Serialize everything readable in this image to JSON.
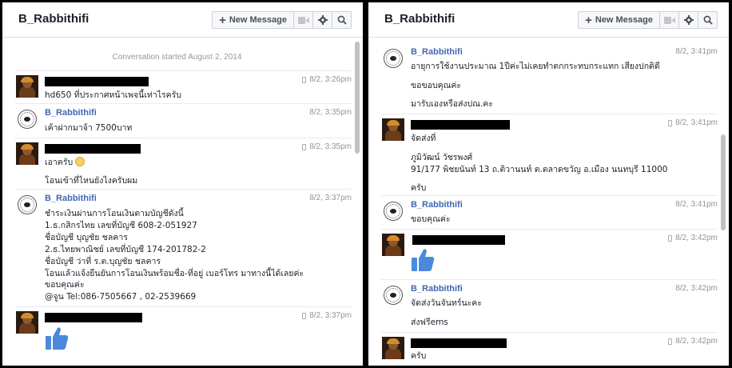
{
  "left": {
    "title": "B_Rabbithifi",
    "toolbar": {
      "new_message": "New Message"
    },
    "conversation_started": "Conversation started August 2, 2014",
    "messages": [
      {
        "sender": "",
        "time": "8/2, 3:26pm",
        "lines": [
          "hd650 ที่ประกาศหน้าเพจนี้เท่าไรครับ"
        ]
      },
      {
        "sender": "B_Rabbithifi",
        "time": "8/2, 3:35pm",
        "lines": [
          "เค้าฝากมาจ้า 7500บาท"
        ]
      },
      {
        "sender": "",
        "time": "8/2, 3:35pm",
        "lines": [
          "เอาครับ",
          "โอนเข้าที่ไหนยังไงครับผม"
        ]
      },
      {
        "sender": "B_Rabbithifi",
        "time": "8/2, 3:37pm",
        "lines": [
          "ชำระเงินผ่านการโอนเงินตามบัญชีดังนี้",
          "1.ธ.กสิกรไทย เลขที่บัญชี 608-2-051927",
          "ชื่อบัญชี บุญชัย ชลคาร",
          "2.ธ.ไทยพาณิชย์ เลขที่บัญชี 174-201782-2",
          "ชื่อบัญชี ว่าที่ ร.ต.บุญชัย ชลคาร",
          "โอนแล้วแจ้งยืนยันการโอนเงินพร้อมชื่อ-ที่อยู่ เบอร์โทร มาทางนี้ได้เลยค่ะ",
          "ขอบคุณค่ะ",
          "@จูน Tel:086-7505667 , 02-2539669"
        ]
      },
      {
        "sender": "",
        "time": "8/2, 3:37pm",
        "lines": []
      }
    ]
  },
  "right": {
    "title": "B_Rabbithifi",
    "toolbar": {
      "new_message": "New Message"
    },
    "messages": [
      {
        "sender": "B_Rabbithifi",
        "time": "8/2, 3:41pm",
        "lines": [
          "อายุการใช้งานประมาณ 1ปีค่ะไม่เคยทำตกกระทบกระแทก เสียงปกติดี",
          "ขอขอบคุณค่ะ",
          "มารับเองหรือส่งปณ.คะ"
        ]
      },
      {
        "sender": "",
        "time": "8/2, 3:41pm",
        "lines": [
          "จัดส่งที่",
          "ภูมิวัฒน์ วัชรพงศ์",
          "91/177 พิชยนันท์ 13 ถ.ติวานนท์ ต.ตลาดขวัญ อ.เมือง นนทบุรี 11000",
          "ครับ"
        ]
      },
      {
        "sender": "B_Rabbithifi",
        "time": "8/2, 3:41pm",
        "lines": [
          "ขอบคุณค่ะ"
        ]
      },
      {
        "sender": "",
        "time": "8/2, 3:42pm",
        "lines": []
      },
      {
        "sender": "B_Rabbithifi",
        "time": "8/2, 3:42pm",
        "lines": [
          "จัดส่งวันจันทร์นะคะ",
          "ส่งฟรีems"
        ]
      },
      {
        "sender": "",
        "time": "8/2, 3:42pm",
        "lines": [
          "ครับ"
        ]
      }
    ]
  },
  "icons": [
    "plus-icon",
    "video-camera-icon",
    "gear-icon",
    "search-icon",
    "phone-icon",
    "smile-emoji-icon",
    "thumbs-up-icon"
  ],
  "colors": {
    "name_blue": "#4267b2",
    "like_blue": "#4a89dc",
    "divider": "#e9ebee"
  }
}
